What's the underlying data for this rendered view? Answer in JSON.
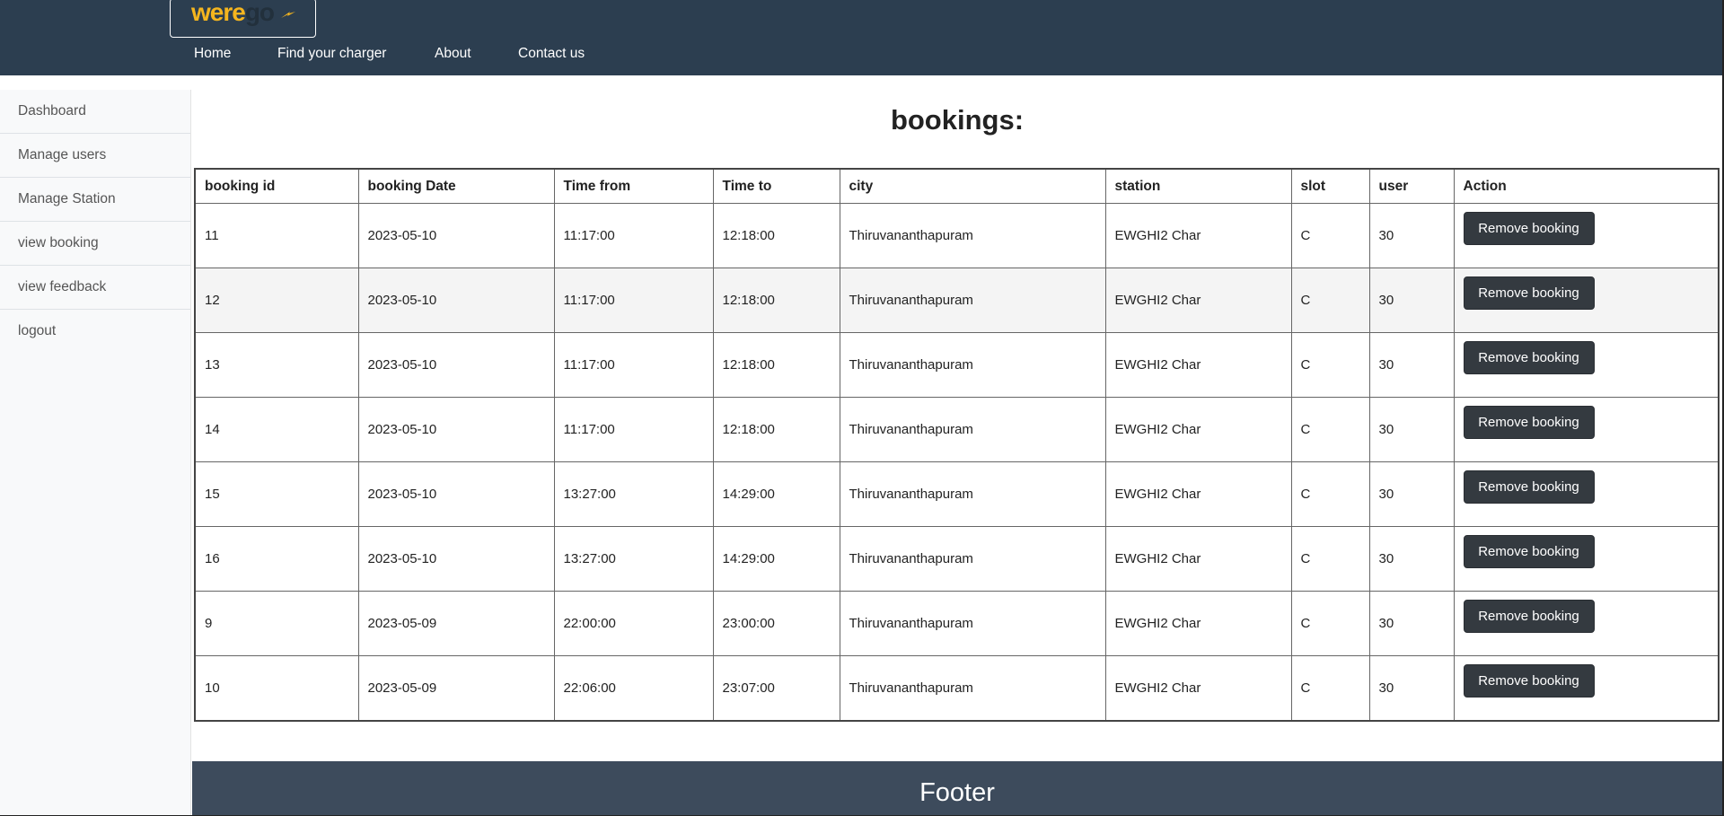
{
  "brand": {
    "part1": "were",
    "part2": "go"
  },
  "nav": [
    "Home",
    "Find your charger",
    "About",
    "Contact us"
  ],
  "sidebar": [
    "Dashboard",
    "Manage users",
    "Manage Station",
    "view booking",
    "view feedback",
    "logout"
  ],
  "page_title": "bookings:",
  "table": {
    "headers": [
      "booking id",
      "booking Date",
      "Time from",
      "Time to",
      "city",
      "station",
      "slot",
      "user",
      "Action"
    ],
    "rows": [
      [
        "11",
        "2023-05-10",
        "11:17:00",
        "12:18:00",
        "Thiruvananthapuram",
        "EWGHI2 Char",
        "C",
        "30"
      ],
      [
        "12",
        "2023-05-10",
        "11:17:00",
        "12:18:00",
        "Thiruvananthapuram",
        "EWGHI2 Char",
        "C",
        "30"
      ],
      [
        "13",
        "2023-05-10",
        "11:17:00",
        "12:18:00",
        "Thiruvananthapuram",
        "EWGHI2 Char",
        "C",
        "30"
      ],
      [
        "14",
        "2023-05-10",
        "11:17:00",
        "12:18:00",
        "Thiruvananthapuram",
        "EWGHI2 Char",
        "C",
        "30"
      ],
      [
        "15",
        "2023-05-10",
        "13:27:00",
        "14:29:00",
        "Thiruvananthapuram",
        "EWGHI2 Char",
        "C",
        "30"
      ],
      [
        "16",
        "2023-05-10",
        "13:27:00",
        "14:29:00",
        "Thiruvananthapuram",
        "EWGHI2 Char",
        "C",
        "30"
      ],
      [
        "9",
        "2023-05-09",
        "22:00:00",
        "23:00:00",
        "Thiruvananthapuram",
        "EWGHI2 Char",
        "C",
        "30"
      ],
      [
        "10",
        "2023-05-09",
        "22:06:00",
        "23:07:00",
        "Thiruvananthapuram",
        "EWGHI2 Char",
        "C",
        "30"
      ]
    ],
    "action_label": "Remove booking"
  },
  "footer": "Footer",
  "colors": {
    "header_bg": "#2c3e50",
    "footer_bg": "#3d4b5c",
    "button_bg": "#343a40",
    "logo_accent": "#f5b51e"
  }
}
